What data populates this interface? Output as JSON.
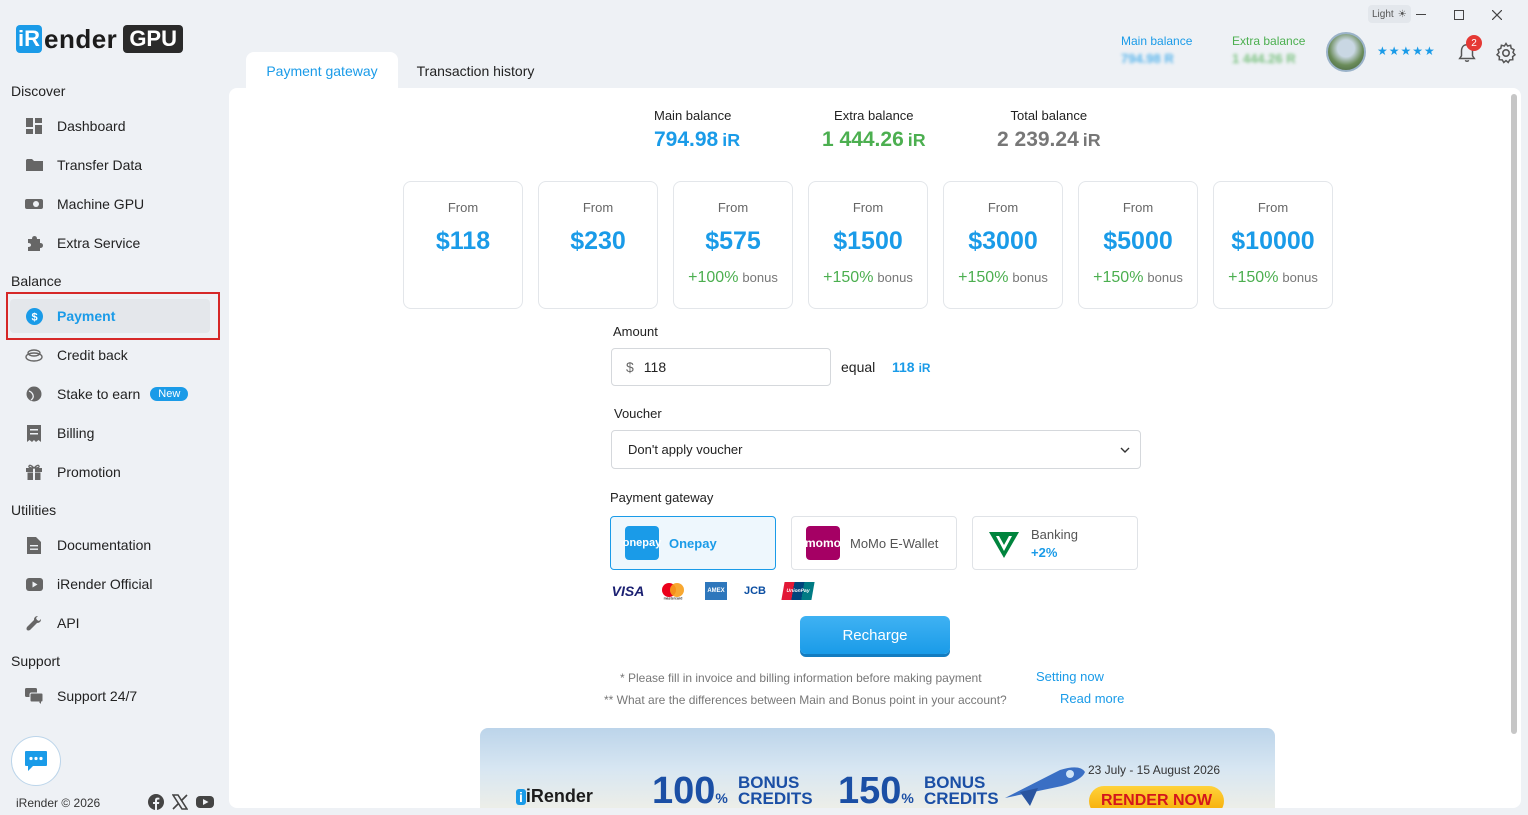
{
  "app": {
    "logo_ir": "iR",
    "logo_ender": "ender",
    "logo_gpu": "GPU",
    "theme_label": "Light"
  },
  "header": {
    "main_balance_label": "Main balance",
    "main_balance_value": "794.98 R",
    "extra_balance_label": "Extra balance",
    "extra_balance_value": "1 444.26 R",
    "rating_stars": "★★★★★",
    "notification_count": "2",
    "colors": {
      "blue": "#1a9be8",
      "green": "#4caf50"
    }
  },
  "sidebar": {
    "discover_title": "Discover",
    "balance_title": "Balance",
    "utilities_title": "Utilities",
    "support_title": "Support",
    "items": {
      "dashboard": "Dashboard",
      "transfer": "Transfer Data",
      "machine": "Machine GPU",
      "extra": "Extra Service",
      "payment": "Payment",
      "credit": "Credit back",
      "stake": "Stake to earn",
      "stake_badge": "New",
      "billing": "Billing",
      "promotion": "Promotion",
      "docs": "Documentation",
      "official": "iRender Official",
      "api": "API",
      "support": "Support 24/7"
    },
    "copyright": "iRender © 2026"
  },
  "tabs": {
    "payment_gateway": "Payment gateway",
    "transaction_history": "Transaction history"
  },
  "balances": {
    "main_label": "Main balance",
    "main_value": "794.98",
    "extra_label": "Extra balance",
    "extra_value": "1 444.26",
    "total_label": "Total balance",
    "total_value": "2 239.24",
    "unit": "iR"
  },
  "packages": [
    {
      "from": "From",
      "price": "$118",
      "bonus_pct": "",
      "bonus_word": ""
    },
    {
      "from": "From",
      "price": "$230",
      "bonus_pct": "",
      "bonus_word": ""
    },
    {
      "from": "From",
      "price": "$575",
      "bonus_pct": "+100%",
      "bonus_word": "bonus"
    },
    {
      "from": "From",
      "price": "$1500",
      "bonus_pct": "+150%",
      "bonus_word": "bonus"
    },
    {
      "from": "From",
      "price": "$3000",
      "bonus_pct": "+150%",
      "bonus_word": "bonus"
    },
    {
      "from": "From",
      "price": "$5000",
      "bonus_pct": "+150%",
      "bonus_word": "bonus"
    },
    {
      "from": "From",
      "price": "$10000",
      "bonus_pct": "+150%",
      "bonus_word": "bonus"
    }
  ],
  "form": {
    "amount_label": "Amount",
    "currency": "$",
    "amount_value": "118",
    "equal_label": "equal",
    "equal_value": "118",
    "voucher_label": "Voucher",
    "voucher_selected": "Don't apply voucher",
    "gateway_label": "Payment gateway"
  },
  "gateways": {
    "onepay": "Onepay",
    "onepay_logo_top": "one",
    "onepay_logo_bottom": "pay",
    "momo": "MoMo E-Wallet",
    "momo_logo_top": "mo",
    "momo_logo_bottom": "mo",
    "banking": "Banking",
    "banking_bonus": "+2%"
  },
  "cards": [
    "VISA",
    "mastercard",
    "AMEX",
    "JCB",
    "UnionPay"
  ],
  "recharge_label": "Recharge",
  "notes": {
    "invoice": "* Please fill in invoice and billing information before making payment",
    "invoice_link": "Setting now",
    "diff": "** What are the differences between Main and Bonus point in your account?",
    "diff_link": "Read more"
  },
  "banner": {
    "brand": "iRender",
    "bonus1_pct": "100",
    "bonus2_pct": "150",
    "percent": "%",
    "bonus_word": "BONUS",
    "credits_word": "CREDITS",
    "dates": "23 July - 15 August 2026",
    "cta": "RENDER NOW"
  }
}
